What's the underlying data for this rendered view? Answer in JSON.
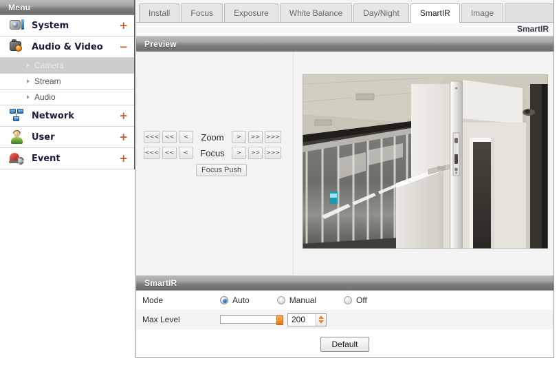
{
  "sidebar": {
    "header": "Menu",
    "items": [
      {
        "label": "System",
        "icon": "camera-system-icon",
        "toggle": "+",
        "expanded": false
      },
      {
        "label": "Audio & Video",
        "icon": "audio-video-icon",
        "toggle": "−",
        "expanded": true
      },
      {
        "label": "Network",
        "icon": "network-icon",
        "toggle": "+",
        "expanded": false
      },
      {
        "label": "User",
        "icon": "user-icon",
        "toggle": "+",
        "expanded": false
      },
      {
        "label": "Event",
        "icon": "event-alarm-icon",
        "toggle": "+",
        "expanded": false
      }
    ],
    "sub_items": [
      {
        "label": "Camera",
        "active": true
      },
      {
        "label": "Stream",
        "active": false
      },
      {
        "label": "Audio",
        "active": false
      }
    ]
  },
  "tabs": [
    {
      "label": "Install",
      "active": false
    },
    {
      "label": "Focus",
      "active": false
    },
    {
      "label": "Exposure",
      "active": false
    },
    {
      "label": "White Balance",
      "active": false
    },
    {
      "label": "Day/Night",
      "active": false
    },
    {
      "label": "SmartIR",
      "active": true
    },
    {
      "label": "Image",
      "active": false
    }
  ],
  "breadcrumb": "SmartIR",
  "preview": {
    "header": "Preview",
    "zoom": {
      "label": "Zoom",
      "left_buttons": [
        "<<<",
        "<<",
        "<"
      ],
      "right_buttons": [
        ">",
        ">>",
        ">>>"
      ]
    },
    "focus": {
      "label": "Focus",
      "left_buttons": [
        "<<<",
        "<<",
        "<"
      ],
      "right_buttons": [
        ">",
        ">>",
        ">>>"
      ]
    },
    "focus_push": "Focus Push",
    "video_alt": "live-camera-preview-indoor-corridor-glass-partition"
  },
  "smartir": {
    "header": "SmartIR",
    "mode": {
      "label": "Mode",
      "options": [
        {
          "label": "Auto",
          "selected": true
        },
        {
          "label": "Manual",
          "selected": false
        },
        {
          "label": "Off",
          "selected": false
        }
      ]
    },
    "max_level": {
      "label": "Max Level",
      "value": "200",
      "slider_percent": 100
    },
    "default_button": "Default"
  },
  "colors": {
    "accent_orange": "#d2541f",
    "slider_handle": "#e07a13",
    "radio_selected": "#19589c",
    "header_gradient_top": "#b8b8b8",
    "header_gradient_bottom": "#6e6e6e"
  }
}
